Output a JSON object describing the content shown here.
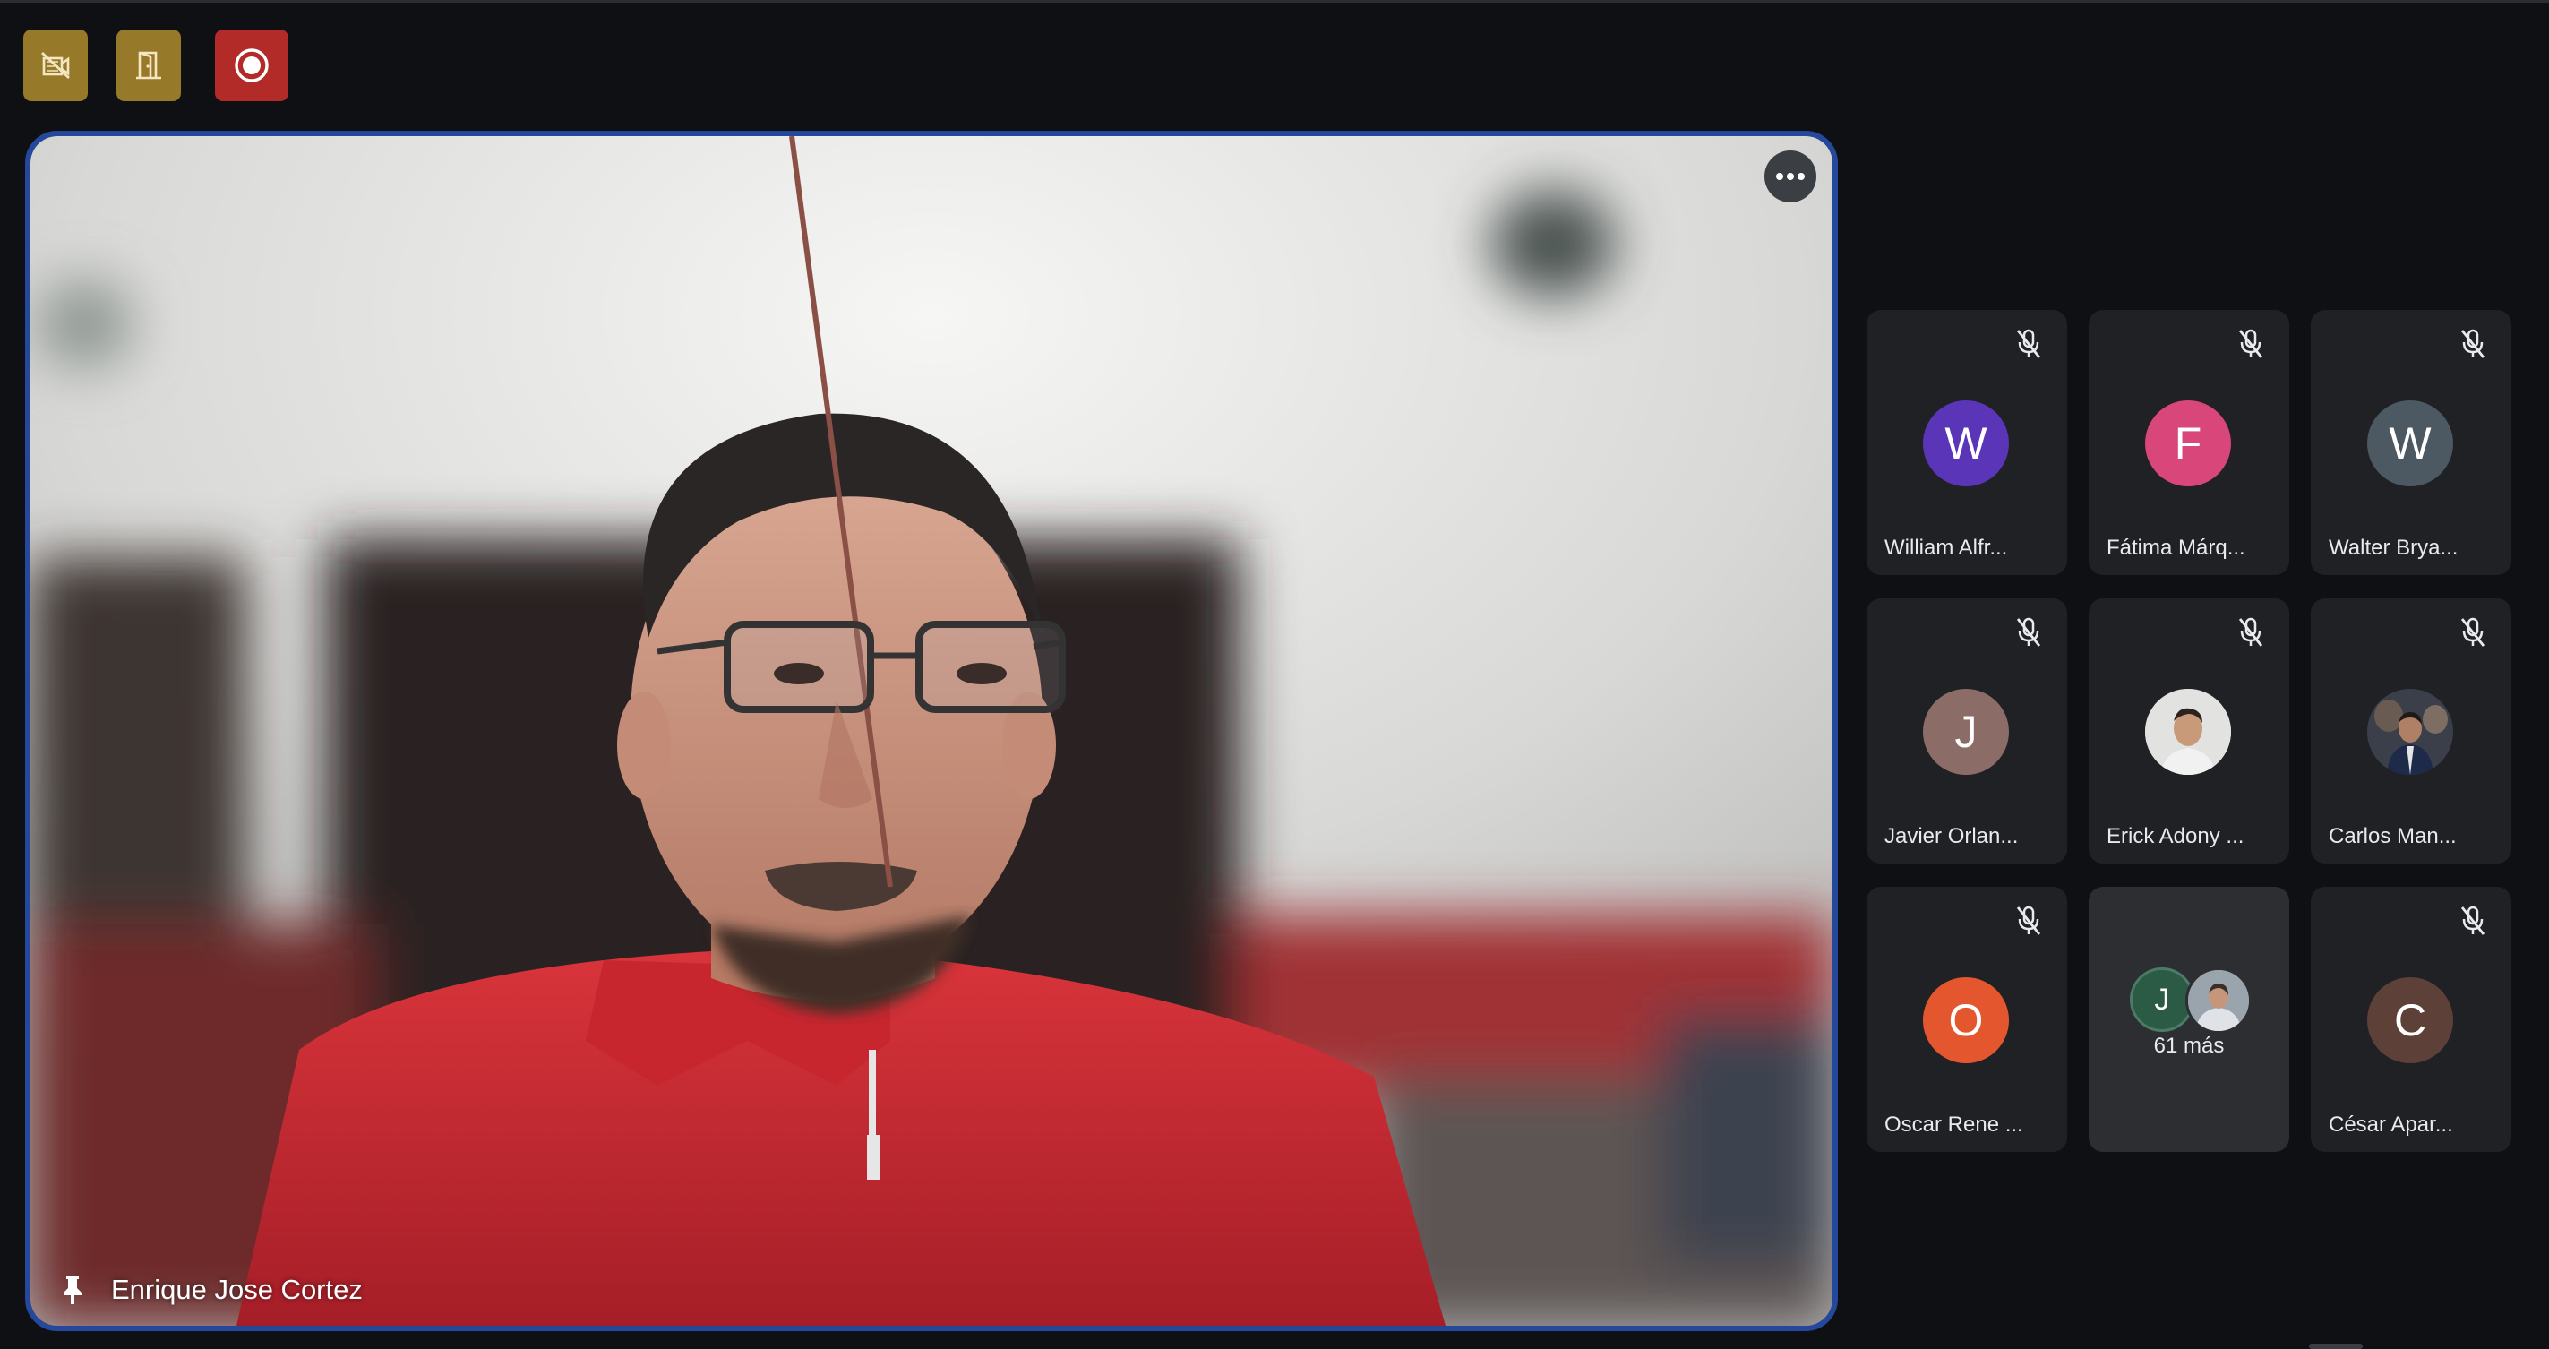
{
  "toolbar": {
    "buttons": [
      {
        "id": "no-camera",
        "icon": "camera-off-icon",
        "color": "#97792a"
      },
      {
        "id": "leave",
        "icon": "door-exit-icon",
        "color": "#97792a"
      },
      {
        "id": "record",
        "icon": "record-icon",
        "color": "#b22b29"
      }
    ]
  },
  "main": {
    "speaker_name": "Enrique Jose Cortez",
    "pin_icon": "pin-icon",
    "more_icon": "more-options-icon",
    "border_color": "#24489c"
  },
  "participants": [
    {
      "name": "William Alfr...",
      "initial": "W",
      "color": "#5a35b8",
      "muted": true
    },
    {
      "name": "Fátima Márq...",
      "initial": "F",
      "color": "#d8467a",
      "muted": true
    },
    {
      "name": "Walter Brya...",
      "initial": "W",
      "color": "#4c5962",
      "muted": true
    },
    {
      "name": "Javier Orlan...",
      "initial": "J",
      "color": "#8c6c66",
      "muted": true
    },
    {
      "name": "Erick Adony ...",
      "initial": "",
      "color": "#c9c9c9",
      "muted": true,
      "photo": true
    },
    {
      "name": "Carlos Man...",
      "initial": "",
      "color": "#2b3140",
      "muted": true,
      "photo": true
    },
    {
      "name": "Oscar Rene ...",
      "initial": "O",
      "color": "#e4572e",
      "muted": true
    },
    {
      "name": "",
      "initial": "J",
      "more_label": "61 más",
      "more": true
    },
    {
      "name": "César Apar...",
      "initial": "C",
      "color": "#5d4038",
      "muted": true
    }
  ]
}
